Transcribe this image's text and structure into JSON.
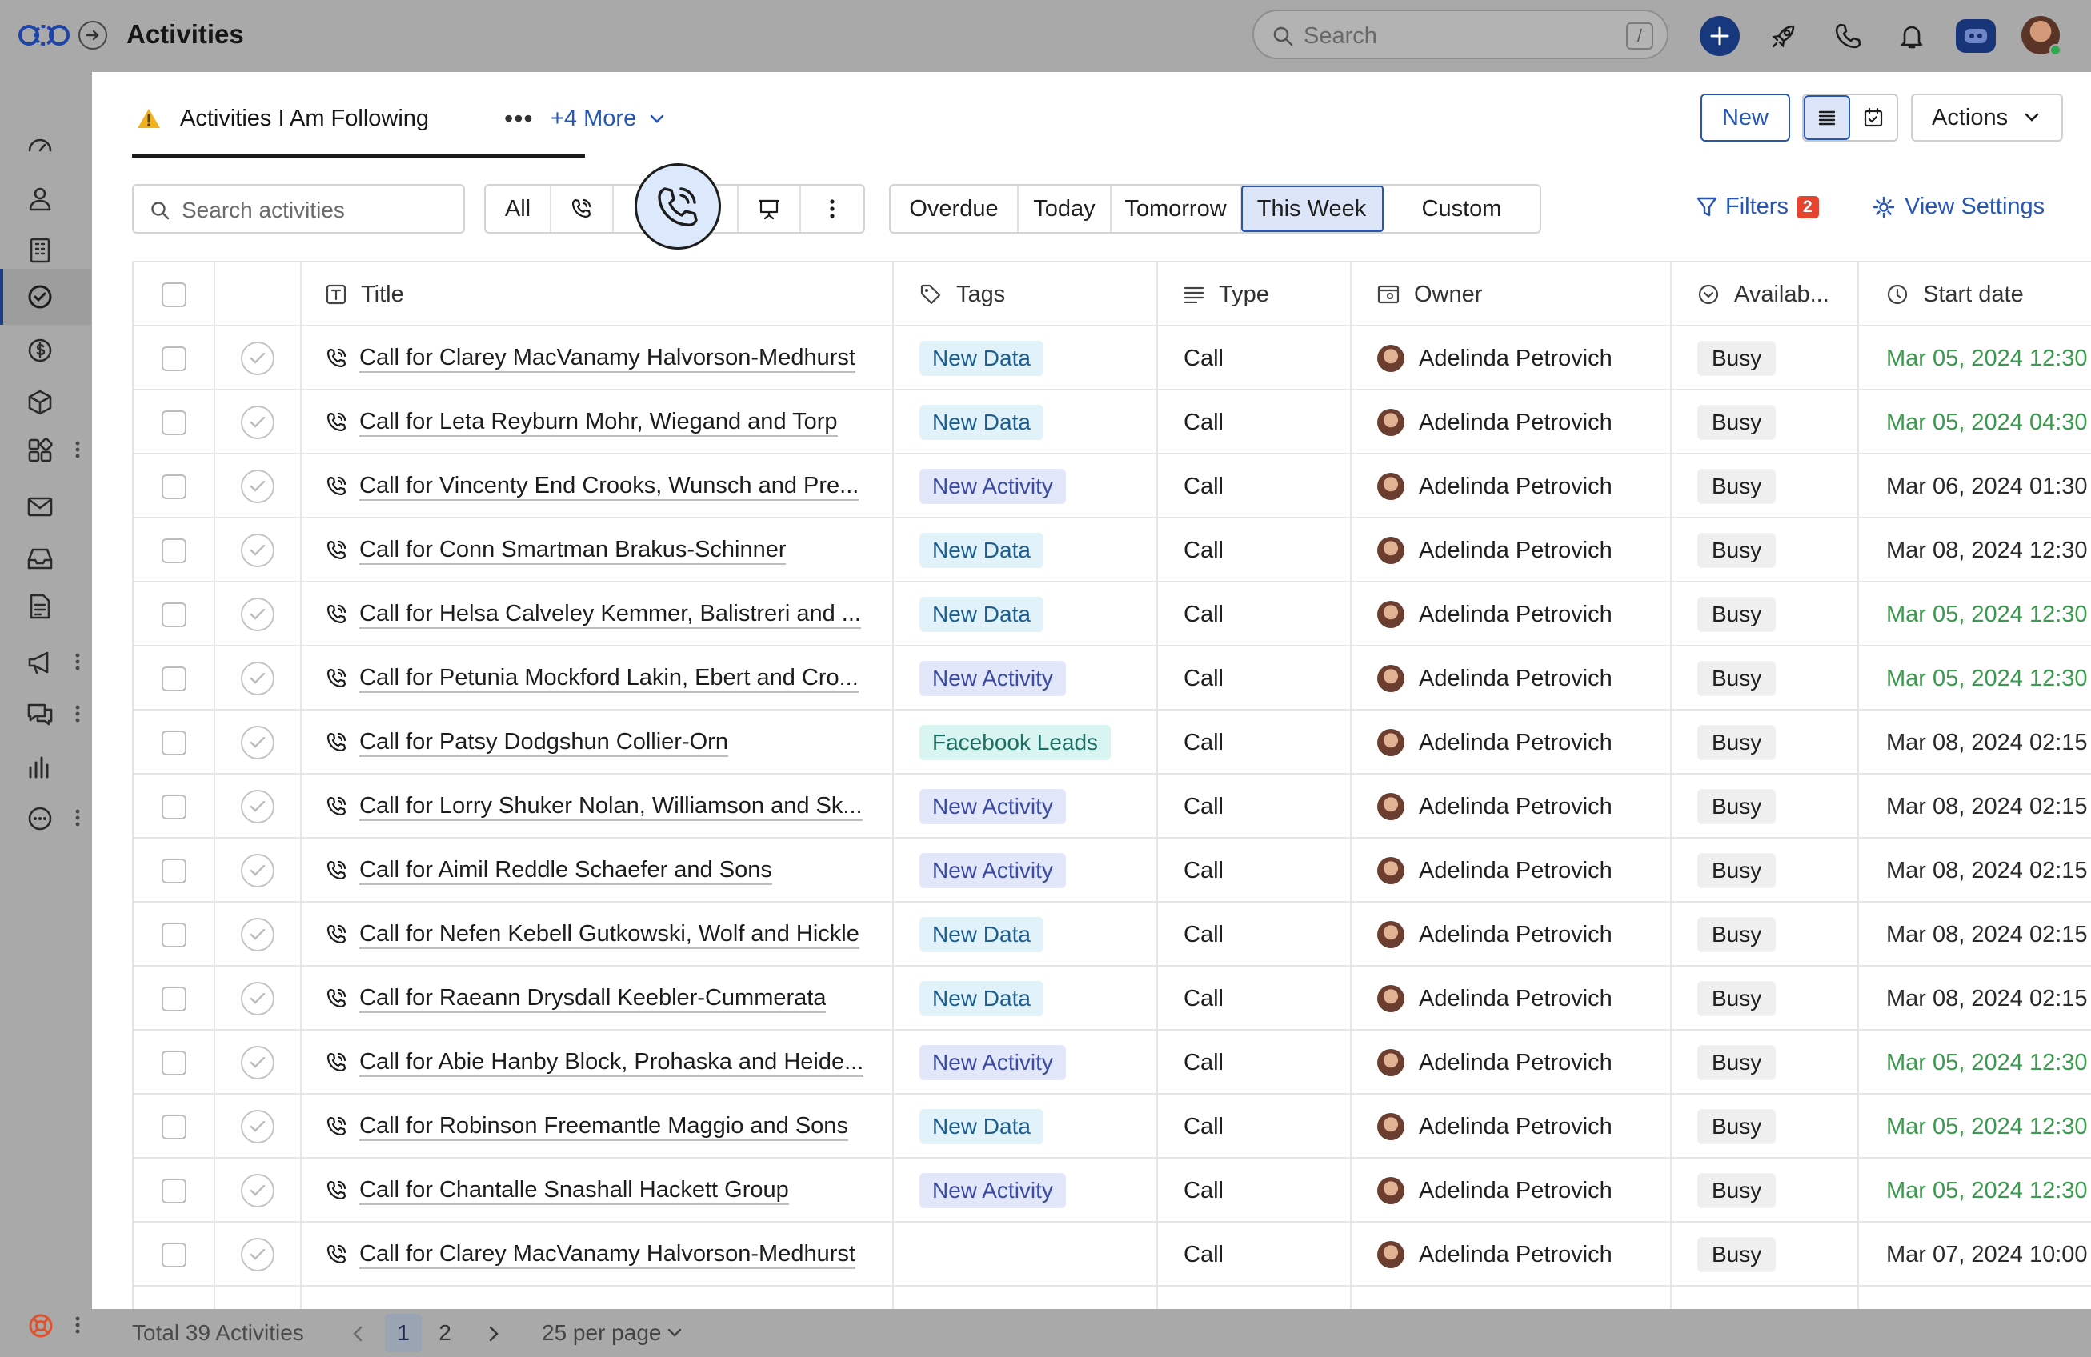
{
  "header": {
    "app_title": "Activities",
    "search_placeholder": "Search",
    "search_shortcut": "/"
  },
  "sidebar": {
    "items": [
      {
        "name": "dashboard",
        "icon": "speedometer-icon"
      },
      {
        "name": "contacts",
        "icon": "person-icon"
      },
      {
        "name": "companies",
        "icon": "building-icon"
      },
      {
        "name": "activities",
        "icon": "check-circle-icon",
        "active": true
      },
      {
        "name": "deals",
        "icon": "dollar-icon"
      },
      {
        "name": "products",
        "icon": "cube-icon"
      },
      {
        "name": "apps",
        "icon": "grid-icon",
        "has_more": true
      },
      {
        "name": "email",
        "icon": "mail-icon"
      },
      {
        "name": "inbox",
        "icon": "inbox-icon"
      },
      {
        "name": "documents",
        "icon": "document-icon"
      },
      {
        "name": "campaigns",
        "icon": "megaphone-icon",
        "has_more": true
      },
      {
        "name": "chat",
        "icon": "chat-icon",
        "has_more": true
      },
      {
        "name": "reports",
        "icon": "bar-chart-icon"
      },
      {
        "name": "more",
        "icon": "more-circle-icon",
        "has_more": true
      }
    ]
  },
  "view": {
    "current_view": "Activities I Am Following",
    "more_views": "+4 More",
    "new_button": "New",
    "actions_button": "Actions"
  },
  "toolbar": {
    "search_placeholder": "Search activities",
    "type_all": "All",
    "date_filters": [
      "Overdue",
      "Today",
      "Tomorrow",
      "This Week",
      "Custom"
    ],
    "active_date_filter": "This Week",
    "filters_label": "Filters",
    "filters_count": "2",
    "view_settings_label": "View Settings"
  },
  "table": {
    "columns": {
      "title": "Title",
      "tags": "Tags",
      "type": "Type",
      "owner": "Owner",
      "availability": "Availab...",
      "start_date": "Start date"
    },
    "rows": [
      {
        "title": "Call for Clarey MacVanamy Halvorson-Medhurst",
        "tag": "New Data",
        "tag_kind": "data",
        "type": "Call",
        "owner": "Adelinda Petrovich",
        "availability": "Busy",
        "start": "Mar 05, 2024 12:30",
        "start_color": "green"
      },
      {
        "title": "Call for Leta Reyburn Mohr, Wiegand and Torp",
        "tag": "New Data",
        "tag_kind": "data",
        "type": "Call",
        "owner": "Adelinda Petrovich",
        "availability": "Busy",
        "start": "Mar 05, 2024 04:30",
        "start_color": "green"
      },
      {
        "title": "Call for Vincenty End Crooks, Wunsch and Pre...",
        "tag": "New Activity",
        "tag_kind": "activity",
        "type": "Call",
        "owner": "Adelinda Petrovich",
        "availability": "Busy",
        "start": "Mar 06, 2024 01:30",
        "start_color": "dark"
      },
      {
        "title": "Call for Conn Smartman Brakus-Schinner",
        "tag": "New Data",
        "tag_kind": "data",
        "type": "Call",
        "owner": "Adelinda Petrovich",
        "availability": "Busy",
        "start": "Mar 08, 2024 12:30",
        "start_color": "dark"
      },
      {
        "title": "Call for Helsa Calveley Kemmer, Balistreri and ...",
        "tag": "New Data",
        "tag_kind": "data",
        "type": "Call",
        "owner": "Adelinda Petrovich",
        "availability": "Busy",
        "start": "Mar 05, 2024 12:30",
        "start_color": "green"
      },
      {
        "title": "Call for Petunia Mockford Lakin, Ebert and Cro...",
        "tag": "New Activity",
        "tag_kind": "activity",
        "type": "Call",
        "owner": "Adelinda Petrovich",
        "availability": "Busy",
        "start": "Mar 05, 2024 12:30",
        "start_color": "green"
      },
      {
        "title": "Call for Patsy Dodgshun Collier-Orn",
        "tag": "Facebook Leads",
        "tag_kind": "fb",
        "type": "Call",
        "owner": "Adelinda Petrovich",
        "availability": "Busy",
        "start": "Mar 08, 2024 02:15",
        "start_color": "dark"
      },
      {
        "title": "Call for Lorry Shuker Nolan, Williamson and Sk...",
        "tag": "New Activity",
        "tag_kind": "activity",
        "type": "Call",
        "owner": "Adelinda Petrovich",
        "availability": "Busy",
        "start": "Mar 08, 2024 02:15",
        "start_color": "dark"
      },
      {
        "title": "Call for Aimil Reddle Schaefer and Sons",
        "tag": "New Activity",
        "tag_kind": "activity",
        "type": "Call",
        "owner": "Adelinda Petrovich",
        "availability": "Busy",
        "start": "Mar 08, 2024 02:15",
        "start_color": "dark"
      },
      {
        "title": "Call for Nefen Kebell Gutkowski, Wolf and Hickle",
        "tag": "New Data",
        "tag_kind": "data",
        "type": "Call",
        "owner": "Adelinda Petrovich",
        "availability": "Busy",
        "start": "Mar 08, 2024 02:15",
        "start_color": "dark"
      },
      {
        "title": "Call for Raeann Drysdall Keebler-Cummerata",
        "tag": "New Data",
        "tag_kind": "data",
        "type": "Call",
        "owner": "Adelinda Petrovich",
        "availability": "Busy",
        "start": "Mar 08, 2024 02:15",
        "start_color": "dark"
      },
      {
        "title": "Call for Abie Hanby Block, Prohaska and Heide...",
        "tag": "New Activity",
        "tag_kind": "activity",
        "type": "Call",
        "owner": "Adelinda Petrovich",
        "availability": "Busy",
        "start": "Mar 05, 2024 12:30",
        "start_color": "green"
      },
      {
        "title": "Call for Robinson Freemantle Maggio and Sons",
        "tag": "New Data",
        "tag_kind": "data",
        "type": "Call",
        "owner": "Adelinda Petrovich",
        "availability": "Busy",
        "start": "Mar 05, 2024 12:30",
        "start_color": "green"
      },
      {
        "title": "Call for Chantalle Snashall Hackett Group",
        "tag": "New Activity",
        "tag_kind": "activity",
        "type": "Call",
        "owner": "Adelinda Petrovich",
        "availability": "Busy",
        "start": "Mar 05, 2024 12:30",
        "start_color": "green"
      },
      {
        "title": "Call for Clarey MacVanamy Halvorson-Medhurst",
        "tag": "",
        "tag_kind": "none",
        "type": "Call",
        "owner": "Adelinda Petrovich",
        "availability": "Busy",
        "start": "Mar 07, 2024 10:00",
        "start_color": "dark"
      }
    ]
  },
  "footer": {
    "total": "Total 39 Activities",
    "pages": [
      "1",
      "2"
    ],
    "current_page": "1",
    "per_page": "25 per page"
  },
  "colors": {
    "accent": "#2856b5",
    "green_date": "#3a9a4c",
    "badge": "#e5452f"
  }
}
